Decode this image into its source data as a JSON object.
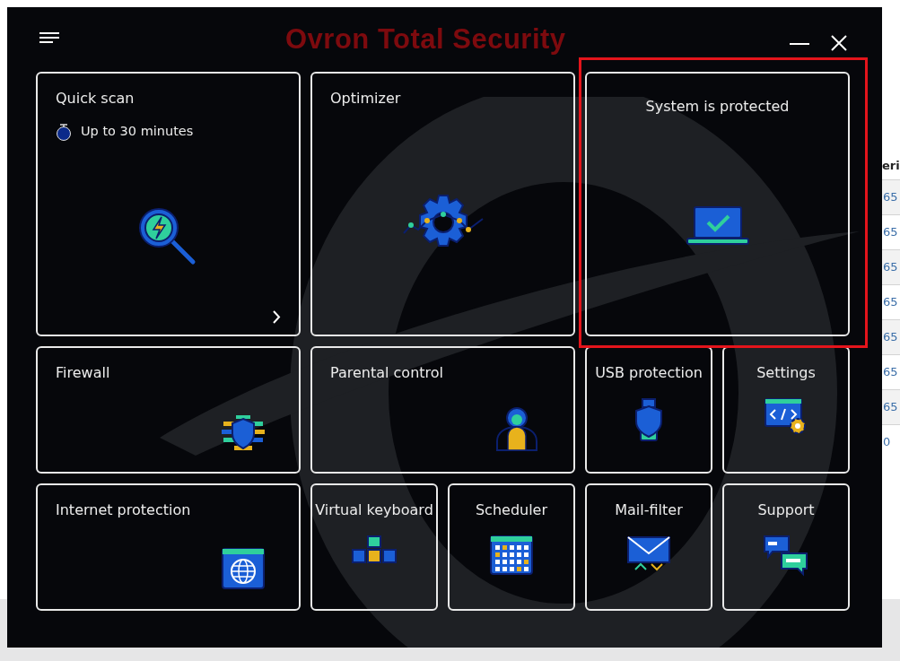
{
  "app": {
    "title": "Ovron Total Security"
  },
  "tiles": [
    {
      "label": "Quick scan",
      "kind": "large",
      "subtitle": "Up to 30 minutes",
      "arrow": true,
      "highlighted": false
    },
    {
      "label": "Optimizer",
      "kind": "large",
      "highlighted": false
    },
    {
      "label": "System is protected",
      "kind": "status",
      "highlighted": true
    },
    {
      "label": "Firewall",
      "kind": "wide",
      "highlighted": false
    },
    {
      "label": "Parental control",
      "kind": "wide",
      "highlighted": false
    },
    {
      "label": "USB protection",
      "kind": "small",
      "highlighted": false
    },
    {
      "label": "Settings",
      "kind": "small",
      "highlighted": false
    },
    {
      "label": "Internet protection",
      "kind": "wide",
      "highlighted": false
    },
    {
      "label": "Virtual keyboard",
      "kind": "small",
      "highlighted": false
    },
    {
      "label": "Scheduler",
      "kind": "small",
      "highlighted": false
    },
    {
      "label": "Mail-filter",
      "kind": "small",
      "highlighted": false
    },
    {
      "label": "Support",
      "kind": "small",
      "highlighted": false
    }
  ],
  "background_table": {
    "column_1": {
      "header": "eri",
      "cells": [
        "65",
        "65",
        "65",
        "65",
        "65",
        "65",
        "65",
        "0"
      ]
    }
  }
}
